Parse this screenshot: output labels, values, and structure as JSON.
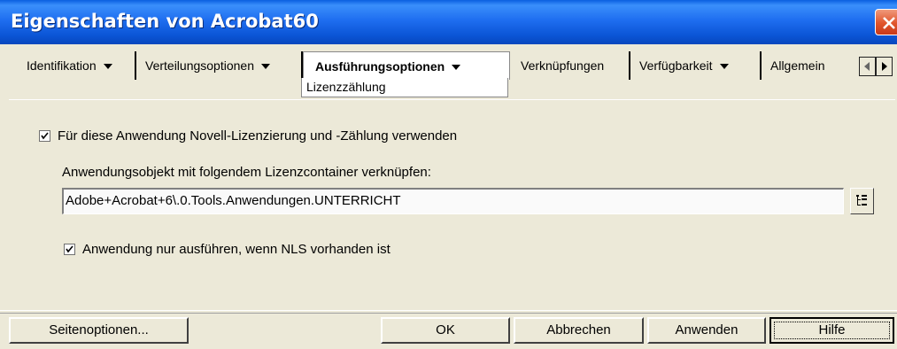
{
  "window": {
    "title": "Eigenschaften von Acrobat60",
    "close_icon": "close-icon",
    "close_color": "#e0542b",
    "titlebar_color": "#0b55d6"
  },
  "tabs": [
    {
      "label": "Identifikation",
      "dropdown": true
    },
    {
      "label": "Verteilungsoptionen",
      "dropdown": true
    },
    {
      "label": "Ausführungsoptionen",
      "dropdown": true,
      "active": true
    },
    {
      "label": "Verknüpfungen",
      "dropdown": false
    },
    {
      "label": "Verfügbarkeit",
      "dropdown": true
    },
    {
      "label": "Allgemein",
      "dropdown": false
    }
  ],
  "subtab": {
    "label": "Lizenzzählung"
  },
  "license": {
    "use_licensing": {
      "label": "Für diese Anwendung Novell-Lizenzierung und -Zählung verwenden",
      "checked": true
    },
    "container_label": "Anwendungsobjekt mit folgendem Lizenzcontainer verknüpfen:",
    "container_value": "Adobe+Acrobat+6\\.0.Tools.Anwendungen.UNTERRICHT",
    "browse_icon": "browse-tree-icon",
    "nls_only": {
      "label": "Anwendung nur ausführen, wenn NLS vorhanden ist",
      "checked": true
    }
  },
  "buttons": {
    "page_options": "Seitenoptionen...",
    "ok": "OK",
    "cancel": "Abbrechen",
    "apply": "Anwenden",
    "help": "Hilfe"
  }
}
